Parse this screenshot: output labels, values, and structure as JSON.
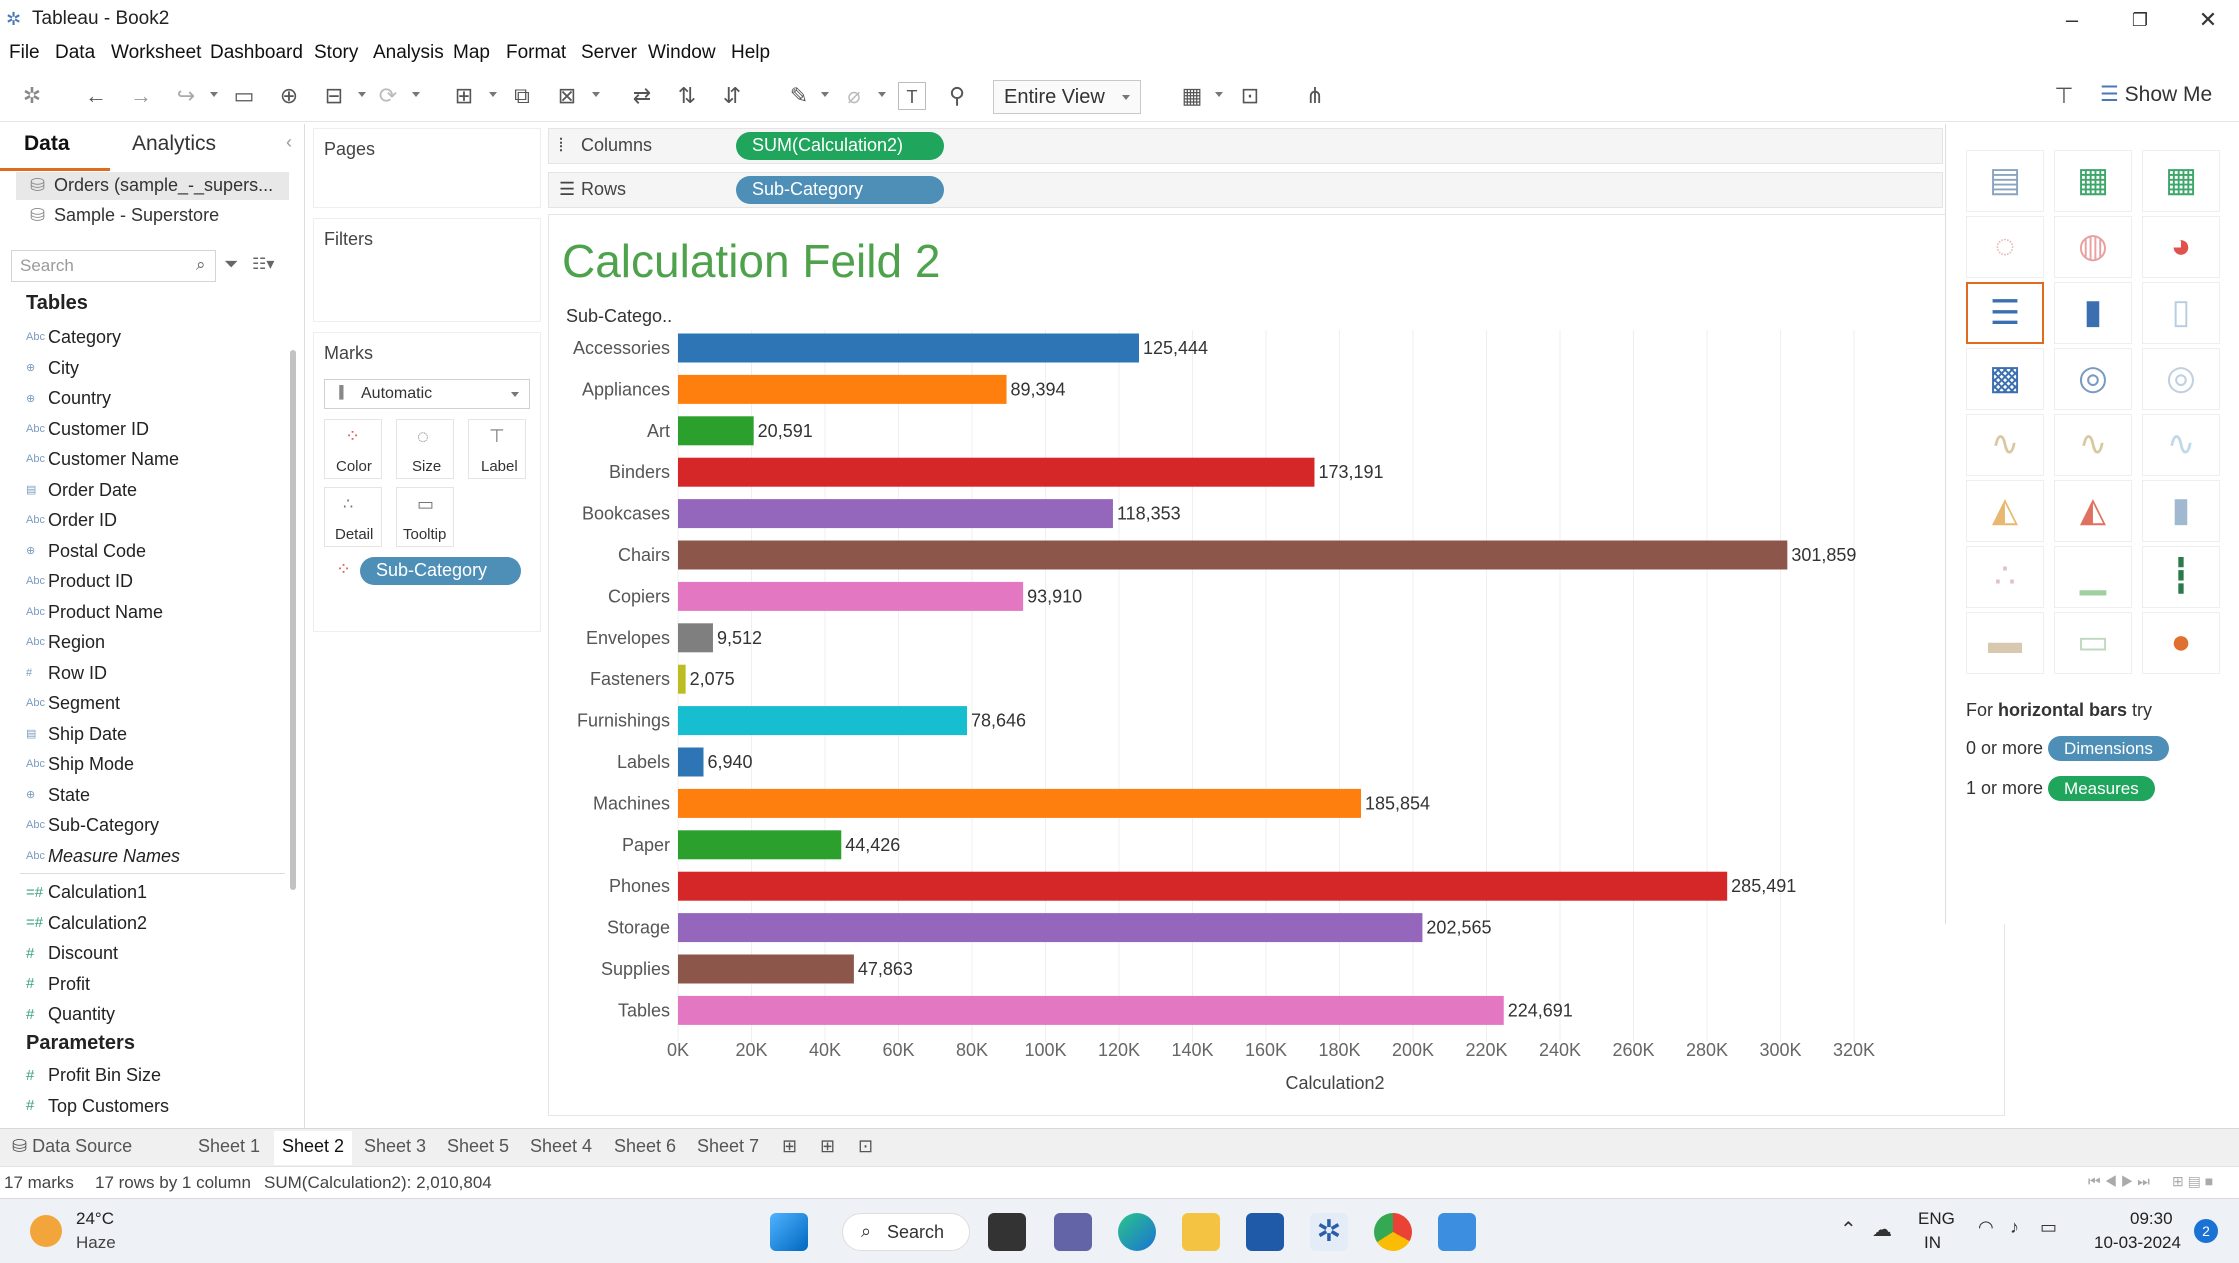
{
  "window": {
    "title": "Tableau - Book2"
  },
  "menu": [
    "File",
    "Data",
    "Worksheet",
    "Dashboard",
    "Story",
    "Analysis",
    "Map",
    "Format",
    "Server",
    "Window",
    "Help"
  ],
  "toolbar": {
    "fit": "Entire View",
    "show_me": "Show Me"
  },
  "left_pane": {
    "tabs": [
      "Data",
      "Analytics"
    ],
    "datasources": [
      "Orders (sample_-_supers...",
      "Sample - Superstore"
    ],
    "search_placeholder": "Search",
    "tables_header": "Tables",
    "dimensions": [
      {
        "type": "abc",
        "name": "Category"
      },
      {
        "type": "geo",
        "name": "City"
      },
      {
        "type": "geo",
        "name": "Country"
      },
      {
        "type": "abc",
        "name": "Customer ID"
      },
      {
        "type": "abc",
        "name": "Customer Name"
      },
      {
        "type": "date",
        "name": "Order Date"
      },
      {
        "type": "abc",
        "name": "Order ID"
      },
      {
        "type": "geo",
        "name": "Postal Code"
      },
      {
        "type": "abc",
        "name": "Product ID"
      },
      {
        "type": "abc",
        "name": "Product Name"
      },
      {
        "type": "abc",
        "name": "Region"
      },
      {
        "type": "num",
        "name": "Row ID"
      },
      {
        "type": "abc",
        "name": "Segment"
      },
      {
        "type": "date",
        "name": "Ship Date"
      },
      {
        "type": "abc",
        "name": "Ship Mode"
      },
      {
        "type": "geo",
        "name": "State"
      },
      {
        "type": "abc",
        "name": "Sub-Category"
      },
      {
        "type": "abc",
        "name": "Measure Names"
      }
    ],
    "measures": [
      {
        "type": "calc",
        "name": "Calculation1"
      },
      {
        "type": "calc",
        "name": "Calculation2"
      },
      {
        "type": "num",
        "name": "Discount"
      },
      {
        "type": "num",
        "name": "Profit"
      },
      {
        "type": "num",
        "name": "Quantity"
      }
    ],
    "parameters_header": "Parameters",
    "parameters": [
      "Profit Bin Size",
      "Top Customers"
    ]
  },
  "cards": {
    "pages": "Pages",
    "filters": "Filters",
    "marks": "Marks",
    "mark_type": "Automatic",
    "mark_buttons": [
      "Color",
      "Size",
      "Label",
      "Detail",
      "Tooltip"
    ],
    "color_pill": "Sub-Category"
  },
  "shelves": {
    "columns_label": "Columns",
    "columns_pill": "SUM(Calculation2)",
    "rows_label": "Rows",
    "rows_pill": "Sub-Category"
  },
  "chart_data": {
    "type": "bar",
    "title": "Calculation Feild 2",
    "ylabel": "Sub-Catego..",
    "xlabel": "Calculation2",
    "orientation": "horizontal",
    "xlim": [
      0,
      320000
    ],
    "x_ticks": [
      "0K",
      "20K",
      "40K",
      "60K",
      "80K",
      "100K",
      "120K",
      "140K",
      "160K",
      "180K",
      "200K",
      "220K",
      "240K",
      "260K",
      "280K",
      "300K",
      "320K"
    ],
    "categories": [
      "Accessories",
      "Appliances",
      "Art",
      "Binders",
      "Bookcases",
      "Chairs",
      "Copiers",
      "Envelopes",
      "Fasteners",
      "Furnishings",
      "Labels",
      "Machines",
      "Paper",
      "Phones",
      "Storage",
      "Supplies",
      "Tables"
    ],
    "values": [
      125444,
      89394,
      20591,
      173191,
      118353,
      301859,
      93910,
      9512,
      2075,
      78646,
      6940,
      185854,
      44426,
      285491,
      202565,
      47863,
      224691
    ],
    "labels": [
      "125,444",
      "89,394",
      "20,591",
      "173,191",
      "118,353",
      "301,859",
      "93,910",
      "9,512",
      "2,075",
      "78,646",
      "6,940",
      "185,854",
      "44,426",
      "285,491",
      "202,565",
      "47,863",
      "224,691"
    ],
    "colors": [
      "#2e75b6",
      "#ff7f0e",
      "#2ca02c",
      "#d62728",
      "#9467bd",
      "#8c564b",
      "#e377c2",
      "#7f7f7f",
      "#bcbd22",
      "#17becf",
      "#2e75b6",
      "#ff7f0e",
      "#2ca02c",
      "#d62728",
      "#9467bd",
      "#8c564b",
      "#e377c2"
    ],
    "grid": true
  },
  "show_me": {
    "hint_prefix": "For ",
    "hint_bold": "horizontal bars",
    "hint_suffix": " try",
    "dim_count": "0 or more",
    "dim_label": "Dimensions",
    "meas_count": "1 or more",
    "meas_label": "Measures"
  },
  "sheets": [
    "Data Source",
    "Sheet 1",
    "Sheet 2",
    "Sheet 3",
    "Sheet 5",
    "Sheet 4",
    "Sheet 6",
    "Sheet 7"
  ],
  "active_sheet": "Sheet 2",
  "status": {
    "marks": "17 marks",
    "rows": "17 rows by 1 column",
    "sum": "SUM(Calculation2): 2,010,804"
  },
  "taskbar": {
    "weather_temp": "24°C",
    "weather_desc": "Haze",
    "search": "Search",
    "lang1": "ENG",
    "lang2": "IN",
    "time": "09:30",
    "date": "10-03-2024",
    "notif": "2"
  }
}
